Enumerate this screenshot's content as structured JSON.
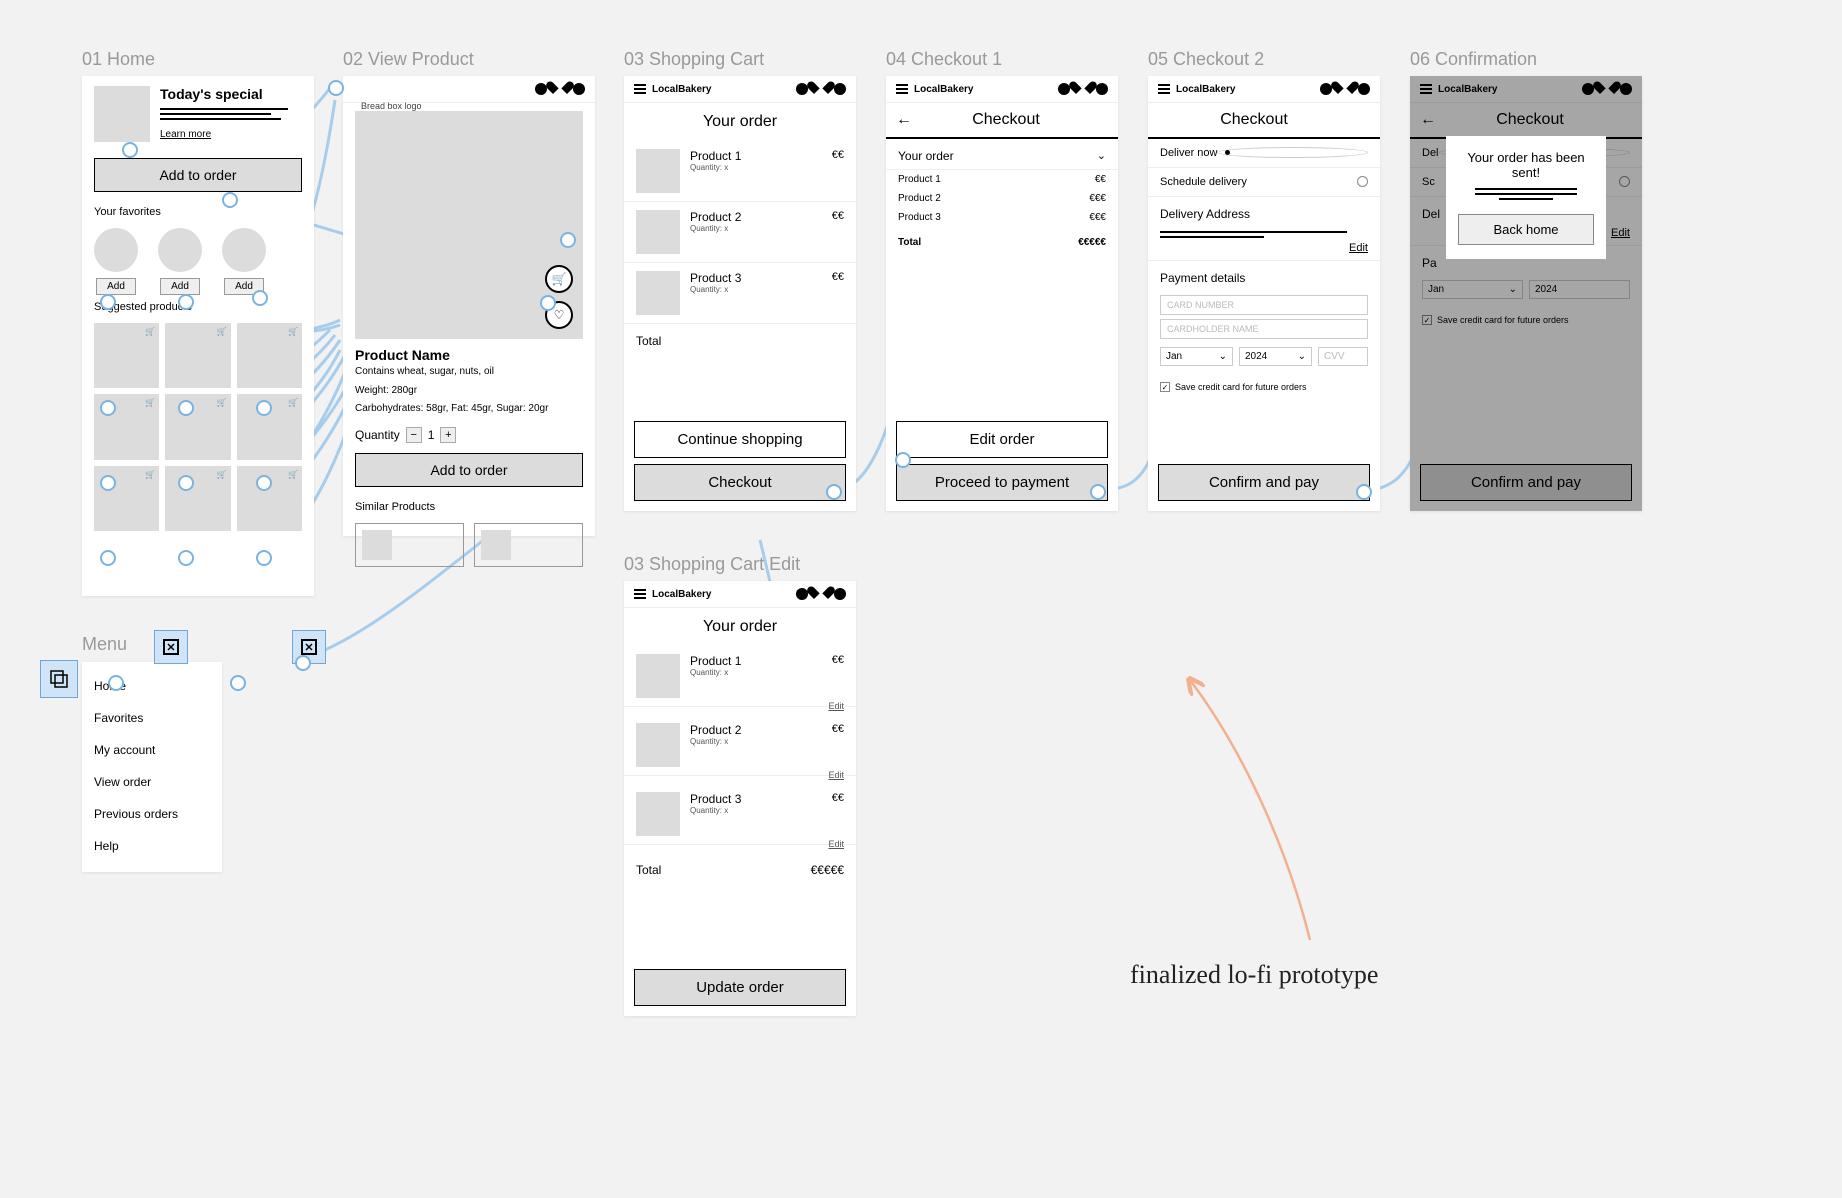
{
  "labels": {
    "f1": "01 Home",
    "f2": "02 View Product",
    "f3": "03 Shopping Cart",
    "f4": "04 Checkout 1",
    "f5": "05 Checkout 2",
    "f6": "06 Confirmation",
    "f3b": "03 Shopping Cart Edit",
    "menu": "Menu"
  },
  "brand": "LocalBakery",
  "home": {
    "special_title": "Today's special",
    "learn": "Learn more",
    "add_to_order": "Add to order",
    "favorites_h": "Your favorites",
    "add": "Add",
    "suggested_h": "Suggested products"
  },
  "product": {
    "logo_label": "Bread box logo",
    "name": "Product Name",
    "desc1": "Contains wheat, sugar, nuts, oil",
    "desc2": "Weight: 280gr",
    "desc3": "Carbohydrates: 58gr, Fat: 45gr, Sugar: 20gr",
    "qty_label": "Quantity",
    "qty_val": "1",
    "add_to_order": "Add to order",
    "similar_h": "Similar Products"
  },
  "cart": {
    "title": "Your order",
    "items": [
      {
        "name": "Product 1",
        "qty": "Quantity: x",
        "price": "€€"
      },
      {
        "name": "Product 2",
        "qty": "Quantity: x",
        "price": "€€"
      },
      {
        "name": "Product 3",
        "qty": "Quantity: x",
        "price": "€€"
      }
    ],
    "total": "Total",
    "edit": "Edit",
    "continue": "Continue shopping",
    "checkout": "Checkout",
    "update": "Update order",
    "total_val": "€€€€€"
  },
  "checkout1": {
    "title": "Checkout",
    "your_order": "Your order",
    "items": [
      {
        "name": "Product 1",
        "price": "€€"
      },
      {
        "name": "Product 2",
        "price": "€€€"
      },
      {
        "name": "Product 3",
        "price": "€€€"
      }
    ],
    "total": "Total",
    "total_val": "€€€€€",
    "edit_order": "Edit order",
    "proceed": "Proceed to payment"
  },
  "checkout2": {
    "title": "Checkout",
    "deliver_now": "Deliver now",
    "schedule": "Schedule delivery",
    "addr_h": "Delivery Address",
    "edit": "Edit",
    "pay_h": "Payment details",
    "card_no": "CARD NUMBER",
    "card_name": "CARDHOLDER NAME",
    "month": "Jan",
    "year": "2024",
    "cvv": "CVV",
    "save": "Save credit card for future orders",
    "confirm": "Confirm and pay"
  },
  "confirm": {
    "msg": "Your order has been sent!",
    "back": "Back home"
  },
  "menu": {
    "items": [
      "Home",
      "Favorites",
      "My account",
      "View order",
      "Previous orders",
      "Help"
    ]
  },
  "annotation": "finalized lo-fi prototype",
  "icon_alts": {
    "cart": "🛒",
    "heart": "♡"
  }
}
